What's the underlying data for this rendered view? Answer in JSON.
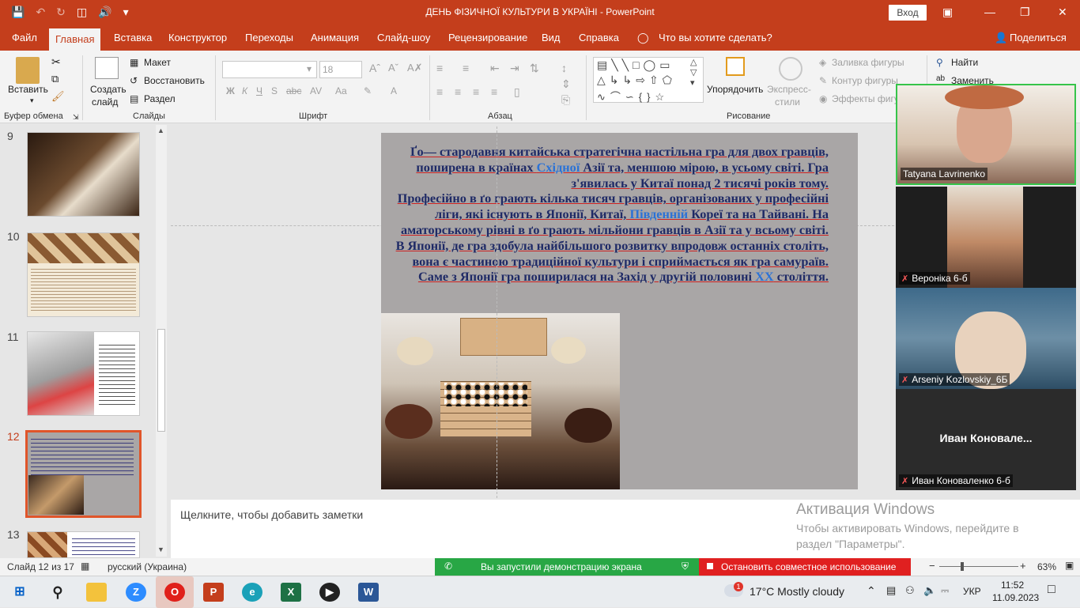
{
  "window": {
    "title": "ДЕНЬ ФІЗИЧНОЇ КУЛЬТУРИ В УКРАЇНІ  -  PowerPoint",
    "signin": "Вход",
    "share": "Поделиться"
  },
  "tabs": [
    "Файл",
    "Главная",
    "Вставка",
    "Конструктор",
    "Переходы",
    "Анимация",
    "Слайд-шоу",
    "Рецензирование",
    "Вид",
    "Справка",
    "Что вы хотите сделать?"
  ],
  "ribbon": {
    "paste": "Вставить",
    "clipboard": "Буфер обмена",
    "new_slide_1": "Создать",
    "new_slide_2": "слайд",
    "layout": "Макет",
    "reset": "Восстановить",
    "section": "Раздел",
    "slides": "Слайды",
    "font_size": "18",
    "font": "Шрифт",
    "paragraph": "Абзац",
    "arrange": "Упорядочить",
    "quick_styles_1": "Экспресс-",
    "quick_styles_2": "стили",
    "fill": "Заливка фигуры",
    "outline": "Контур фигуры",
    "effects": "Эффекты фигур",
    "drawing": "Рисование",
    "find": "Найти",
    "replace": "Заменить",
    "bold": "Ж",
    "italic": "К",
    "underline": "Ч",
    "strike": "S"
  },
  "slides_panel": {
    "numbers": [
      "9",
      "10",
      "11",
      "12",
      "13"
    ]
  },
  "slide": {
    "p1a": "Ґо— стародавня китайська стратегічна настільна гра для двох гравців, поширена в країнах ",
    "p1link": "Східної",
    "p1b": " Азії та, меншою мірою, в усьому світі. Гра з'явилась у Китаї понад 2 тисячі років тому.",
    "p2a": "Професійно в ґо грають кілька тисяч гравців, організованих у професійні ліги, які існують в Японії, Китаї, ",
    "p2link": "Південній",
    "p2b": " Кореї та на Тайвані. На аматорському рівні в ґо грають мільйони гравців в Азії та у всьому світі.",
    "p3a": "В Японії, де гра здобула найбільшого розвитку впродовж останніх століть, вона є частиною традиційної культури і сприймається як гра самураїв. Саме з Японії гра поширилася на Захід у другій половині ",
    "p3link": "XX",
    "p3b": " століття."
  },
  "notes": "Щелкните, чтобы добавить заметки",
  "activation": {
    "title": "Активация Windows",
    "body": "Чтобы активировать Windows, перейдите в раздел \"Параметры\"."
  },
  "status": {
    "slide": "Слайд 12 из 17",
    "lang": "русский (Украина)",
    "zoom": "63%"
  },
  "share_bar": {
    "started": "Вы запустили демонстрацию экрана",
    "stop": "Остановить совместное использование"
  },
  "participants": [
    "Tatyana Lavrinenko",
    "Вероніка 6-б",
    "Arseniy Kozlovskiy_6Б",
    "Иван  Коновале...",
    "Иван Коноваленко 6-б"
  ],
  "taskbar": {
    "weather": "17°C  Mostly cloudy",
    "lang": "УКР",
    "time": "11:52",
    "date": "11.09.2023",
    "badge": "1"
  }
}
